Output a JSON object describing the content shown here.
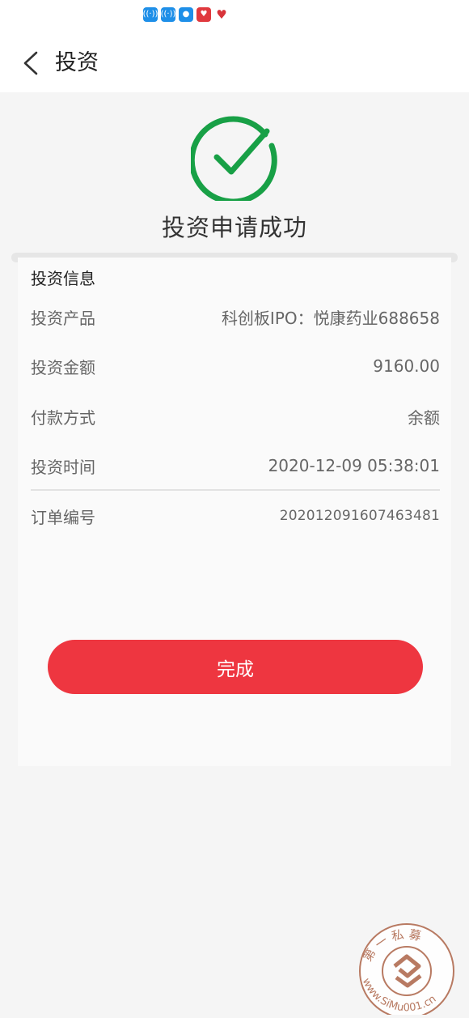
{
  "status_bar": {
    "icons": [
      "wifi-signal-icon",
      "wifi-signal-icon",
      "bulb-icon",
      "heart-app-icon",
      "heart-app-icon"
    ]
  },
  "nav": {
    "title": "投资",
    "back_icon": "chevron-left-icon"
  },
  "result": {
    "icon": "check-circle-icon",
    "title": "投资申请成功",
    "color": "#18a046"
  },
  "info": {
    "section_title": "投资信息",
    "rows": [
      {
        "label": "投资产品",
        "value": "科创板IPO：悦康药业688658"
      },
      {
        "label": "投资金额",
        "value": "9160.00"
      },
      {
        "label": "付款方式",
        "value": "余额"
      },
      {
        "label": "投资时间",
        "value": "2020-12-09 05:38:01"
      },
      {
        "label": "订单编号",
        "value": "202012091607463481"
      }
    ]
  },
  "actions": {
    "done_label": "完成",
    "done_color": "#ee3640"
  },
  "watermark": {
    "top_text": "第 一 私 募",
    "bottom_text": "www.SiMu001.cn"
  }
}
